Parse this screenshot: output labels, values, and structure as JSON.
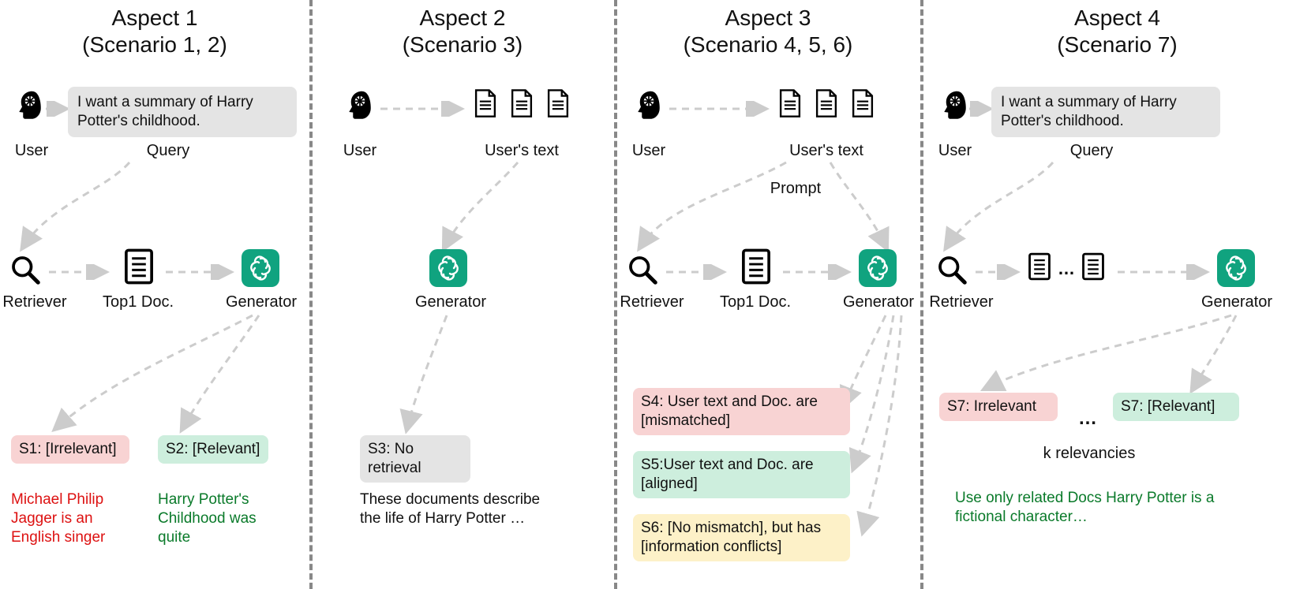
{
  "aspect1": {
    "title_line1": "Aspect 1",
    "title_line2": "(Scenario 1, 2)",
    "user_label": "User",
    "query_label": "Query",
    "query_text": "I want a summary of Harry Potter's childhood.",
    "retriever_label": "Retriever",
    "doc_label": "Top1 Doc.",
    "generator_label": "Generator",
    "s1_label": "S1: [Irrelevant]",
    "s1_text": "Michael Philip Jagger is an English singer",
    "s2_label": "S2: [Relevant]",
    "s2_text": "Harry Potter's Childhood was quite"
  },
  "aspect2": {
    "title_line1": "Aspect 2",
    "title_line2": "(Scenario 3)",
    "user_label": "User",
    "usertext_label": "User's text",
    "generator_label": "Generator",
    "s3_label": "S3: No retrieval",
    "s3_text": "These documents describe the life of Harry Potter …"
  },
  "aspect3": {
    "title_line1": "Aspect 3",
    "title_line2": "(Scenario 4, 5, 6)",
    "user_label": "User",
    "usertext_label": "User's text",
    "prompt_label": "Prompt",
    "retriever_label": "Retriever",
    "doc_label": "Top1 Doc.",
    "generator_label": "Generator",
    "s4_label": "S4: User text and Doc. are [mismatched]",
    "s5_label": "S5:User text and Doc. are [aligned]",
    "s6_label": "S6: [No mismatch], but has [information conflicts]"
  },
  "aspect4": {
    "title_line1": "Aspect 4",
    "title_line2": "(Scenario 7)",
    "user_label": "User",
    "query_label": "Query",
    "query_text": "I want a summary of Harry Potter's childhood.",
    "retriever_label": "Retriever",
    "generator_label": "Generator",
    "s7a_label": "S7: Irrelevant",
    "s7b_label": "S7: [Relevant]",
    "ellipsis": "…",
    "k_label": "k relevancies",
    "final_text": "Use only related Docs Harry Potter is a fictional character…"
  }
}
